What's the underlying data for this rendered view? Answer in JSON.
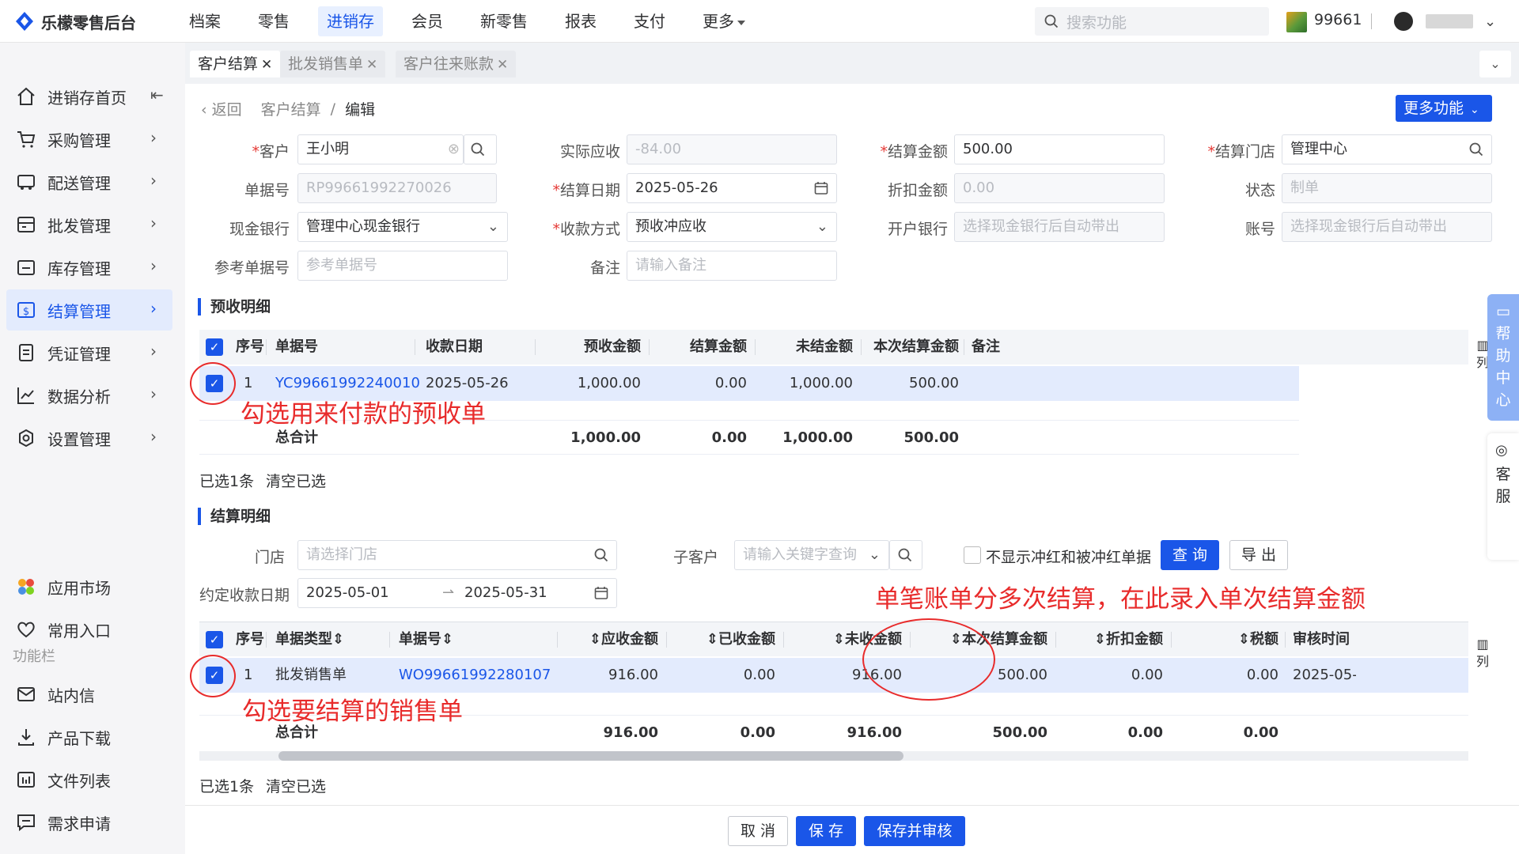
{
  "app": {
    "title": "乐檬零售后台",
    "store_code": "99661"
  },
  "topnav": [
    {
      "label": "档案"
    },
    {
      "label": "零售"
    },
    {
      "label": "进销存"
    },
    {
      "label": "会员"
    },
    {
      "label": "新零售"
    },
    {
      "label": "报表"
    },
    {
      "label": "支付"
    },
    {
      "label": "更多"
    }
  ],
  "search": {
    "placeholder": "搜索功能"
  },
  "sidebar": {
    "items": [
      {
        "label": "进销存首页"
      },
      {
        "label": "采购管理"
      },
      {
        "label": "配送管理"
      },
      {
        "label": "批发管理"
      },
      {
        "label": "库存管理"
      },
      {
        "label": "结算管理"
      },
      {
        "label": "凭证管理"
      },
      {
        "label": "数据分析"
      },
      {
        "label": "设置管理"
      }
    ],
    "apps": [
      {
        "label": "应用市场"
      },
      {
        "label": "常用入口"
      }
    ],
    "section_label": "功能栏",
    "tools": [
      {
        "label": "站内信"
      },
      {
        "label": "产品下载"
      },
      {
        "label": "文件列表"
      },
      {
        "label": "需求申请"
      }
    ]
  },
  "tabs": [
    {
      "label": "客户结算"
    },
    {
      "label": "批发销售单"
    },
    {
      "label": "客户往来账款"
    }
  ],
  "breadcrumb": {
    "back": "返回",
    "parent": "客户结算",
    "sep": "/",
    "current": "编辑"
  },
  "more_functions": "更多功能",
  "form": {
    "customer": {
      "label": "客户",
      "value": "王小明"
    },
    "actual_receivable": {
      "label": "实际应收",
      "value": "-84.00"
    },
    "settle_amount": {
      "label": "结算金额",
      "value": "500.00"
    },
    "settle_store": {
      "label": "结算门店",
      "value": "管理中心"
    },
    "doc_no": {
      "label": "单据号",
      "value": "RP99661992270026"
    },
    "settle_date": {
      "label": "结算日期",
      "value": "2025-05-26"
    },
    "discount": {
      "label": "折扣金额",
      "value": "0.00"
    },
    "status": {
      "label": "状态",
      "value": "制单"
    },
    "cash_bank": {
      "label": "现金银行",
      "value": "管理中心现金银行"
    },
    "pay_method": {
      "label": "收款方式",
      "value": "预收冲应收"
    },
    "open_bank": {
      "label": "开户银行",
      "placeholder": "选择现金银行后自动带出"
    },
    "account": {
      "label": "账号",
      "placeholder": "选择现金银行后自动带出"
    },
    "ref_no": {
      "label": "参考单据号",
      "placeholder": "参考单据号"
    },
    "remark": {
      "label": "备注",
      "placeholder": "请输入备注"
    }
  },
  "prepay": {
    "title": "预收明细",
    "headers": [
      "序号",
      "单据号",
      "收款日期",
      "预收金额",
      "结算金额",
      "未结金额",
      "本次结算金额",
      "备注"
    ],
    "rows": [
      {
        "seq": "1",
        "doc": "YC99661992240010",
        "date": "2025-05-26",
        "prepay": "1,000.00",
        "settled": "0.00",
        "unsettled": "1,000.00",
        "this": "500.00"
      }
    ],
    "total": {
      "label": "总合计",
      "prepay": "1,000.00",
      "settled": "0.00",
      "unsettled": "1,000.00",
      "this": "500.00"
    },
    "selected": "已选1条",
    "clear": "清空已选",
    "column_toggle": "列"
  },
  "settle": {
    "title": "结算明细",
    "store_label": "门店",
    "store_placeholder": "请选择门店",
    "sub_customer_label": "子客户",
    "sub_customer_placeholder": "请输入关键字查询",
    "hide_red_label": "不显示冲红和被冲红单据",
    "query_btn": "查 询",
    "export_btn": "导 出",
    "date_label": "约定收款日期",
    "date_from": "2025-05-01",
    "date_to": "2025-05-31",
    "headers": [
      "序号",
      "单据类型",
      "单据号",
      "应收金额",
      "已收金额",
      "未收金额",
      "本次结算金额",
      "折扣金额",
      "税额",
      "审核时间"
    ],
    "rows": [
      {
        "seq": "1",
        "type": "批发销售单",
        "doc": "WO99661992280107",
        "receivable": "916.00",
        "received": "0.00",
        "unreceived": "916.00",
        "this": "500.00",
        "discount": "0.00",
        "tax": "0.00",
        "audit": "2025-05-"
      }
    ],
    "total": {
      "label": "总合计",
      "receivable": "916.00",
      "received": "0.00",
      "unreceived": "916.00",
      "this": "500.00",
      "discount": "0.00",
      "tax": "0.00"
    },
    "selected": "已选1条",
    "clear": "清空已选",
    "column_toggle": "列"
  },
  "annotations": {
    "prepay_note": "勾选用来付款的预收单",
    "sale_note": "勾选要结算的销售单",
    "split_note": "单笔账单分多次结算，在此录入单次结算金额"
  },
  "footer": {
    "cancel": "取 消",
    "save": "保 存",
    "save_audit": "保存并审核"
  },
  "float": {
    "help": "帮助中心",
    "service": "客服"
  },
  "colors": {
    "accent": "#1a56e8",
    "annotation": "#e82b2b",
    "selected_row": "#e3ebfd"
  }
}
